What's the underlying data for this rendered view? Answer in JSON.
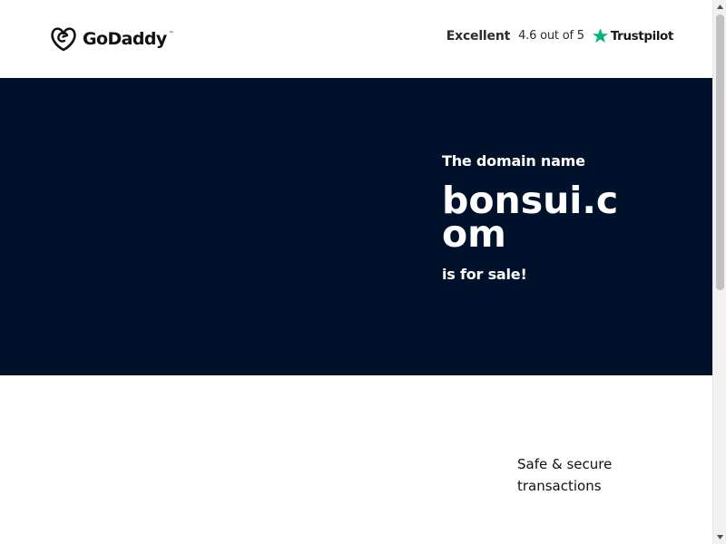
{
  "header": {
    "logo_text": "GoDaddy",
    "logo_tm": "™",
    "rating": {
      "word": "Excellent",
      "score": "4.6 out of 5",
      "provider": "Trustpilot",
      "star_color": "#00b67a"
    }
  },
  "hero": {
    "pre": "The domain name",
    "domain": "bonsui.com",
    "post": "is for sale!",
    "bg_color": "#00112c"
  },
  "features": {
    "secure_label": "Safe & secure transactions"
  },
  "icons": [
    "godaddy-logo-icon",
    "trustpilot-star-icon",
    "scroll-up-arrow-icon",
    "scroll-down-arrow-icon"
  ]
}
